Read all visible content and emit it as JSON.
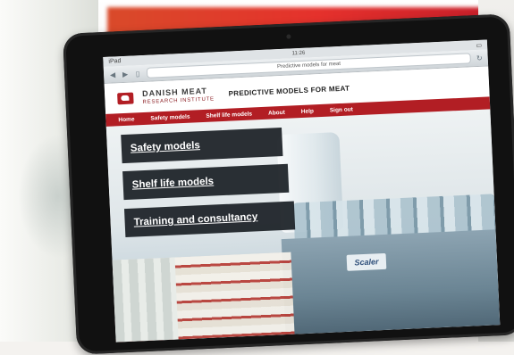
{
  "browser": {
    "time": "11:26",
    "carrier": "iPad",
    "url": "Predictive models for meat"
  },
  "site": {
    "logo_line1": "DANISH MEAT",
    "logo_line2": "RESEARCH INSTITUTE",
    "tagline": "PREDICTIVE MODELS FOR MEAT",
    "nav": [
      "Home",
      "Safety models",
      "Shelf life models",
      "About",
      "Help",
      "Sign out"
    ]
  },
  "hero": {
    "menu": [
      "Safety models",
      "Shelf life models",
      "Training and consultancy"
    ],
    "machine_label": "Scaler"
  },
  "colors": {
    "brand_red": "#b21e24",
    "menu_bg": "#191e24"
  }
}
